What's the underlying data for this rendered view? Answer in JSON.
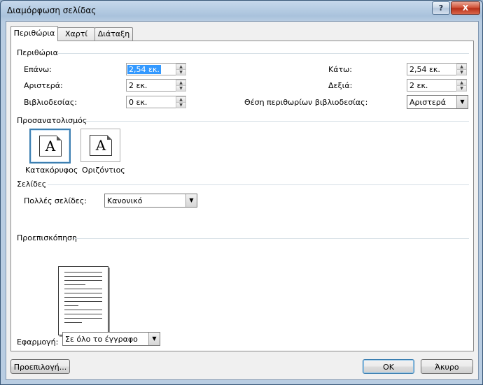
{
  "window": {
    "title": "Διαμόρφωση σελίδας",
    "help_label": "?",
    "close_label": "X"
  },
  "tabs": [
    {
      "label": "Περιθώρια",
      "active": true
    },
    {
      "label": "Χαρτί",
      "active": false
    },
    {
      "label": "Διάταξη",
      "active": false
    }
  ],
  "margins": {
    "group_label": "Περιθώρια",
    "top": {
      "label": "Επάνω:",
      "value": "2,54 εκ."
    },
    "bottom": {
      "label": "Κάτω:",
      "value": "2,54 εκ."
    },
    "left": {
      "label": "Αριστερά:",
      "value": "2 εκ."
    },
    "right": {
      "label": "Δεξιά:",
      "value": "2 εκ."
    },
    "gutter": {
      "label": "Βιβλιοδεσίας:",
      "value": "0 εκ."
    },
    "gutter_position": {
      "label": "Θέση περιθωρίων βιβλιοδεσίας:",
      "value": "Αριστερά"
    }
  },
  "orientation": {
    "group_label": "Προσανατολισμός",
    "icon_glyph": "A",
    "portrait": "Κατακόρυφος",
    "landscape": "Οριζόντιος",
    "selected": "portrait"
  },
  "pages": {
    "group_label": "Σελίδες",
    "multiple_label": "Πολλές σελίδες:",
    "multiple_value": "Κανονικό"
  },
  "preview": {
    "group_label": "Προεπισκόπηση"
  },
  "apply": {
    "label": "Εφαρμογή:",
    "value": "Σε όλο το έγγραφο"
  },
  "buttons": {
    "default": "Προεπιλογή...",
    "ok": "OK",
    "cancel": "Άκυρο"
  }
}
